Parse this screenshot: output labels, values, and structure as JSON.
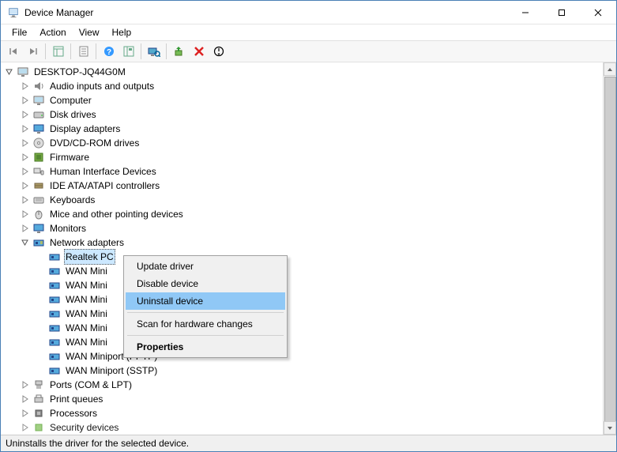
{
  "window": {
    "title": "Device Manager"
  },
  "menu": {
    "file": "File",
    "action": "Action",
    "view": "View",
    "help": "Help"
  },
  "root": "DESKTOP-JQ44G0M",
  "cat": {
    "audio": "Audio inputs and outputs",
    "computer": "Computer",
    "disk": "Disk drives",
    "display": "Display adapters",
    "dvd": "DVD/CD-ROM drives",
    "firmware": "Firmware",
    "hid": "Human Interface Devices",
    "ide": "IDE ATA/ATAPI controllers",
    "keyboards": "Keyboards",
    "mice": "Mice and other pointing devices",
    "monitors": "Monitors",
    "net": "Network adapters",
    "ports": "Ports (COM & LPT)",
    "printq": "Print queues",
    "proc": "Processors",
    "sec": "Security devices"
  },
  "net": {
    "n0": "Realtek PC",
    "n1": "WAN Mini",
    "n2": "WAN Mini",
    "n3": "WAN Mini",
    "n4": "WAN Mini",
    "n5": "WAN Mini",
    "n6": "WAN Mini",
    "n7": "WAN Miniport (PPTP)",
    "n8": "WAN Miniport (SSTP)"
  },
  "ctx": {
    "update": "Update driver",
    "disable": "Disable device",
    "uninstall": "Uninstall device",
    "scan": "Scan for hardware changes",
    "properties": "Properties"
  },
  "status": "Uninstalls the driver for the selected device."
}
